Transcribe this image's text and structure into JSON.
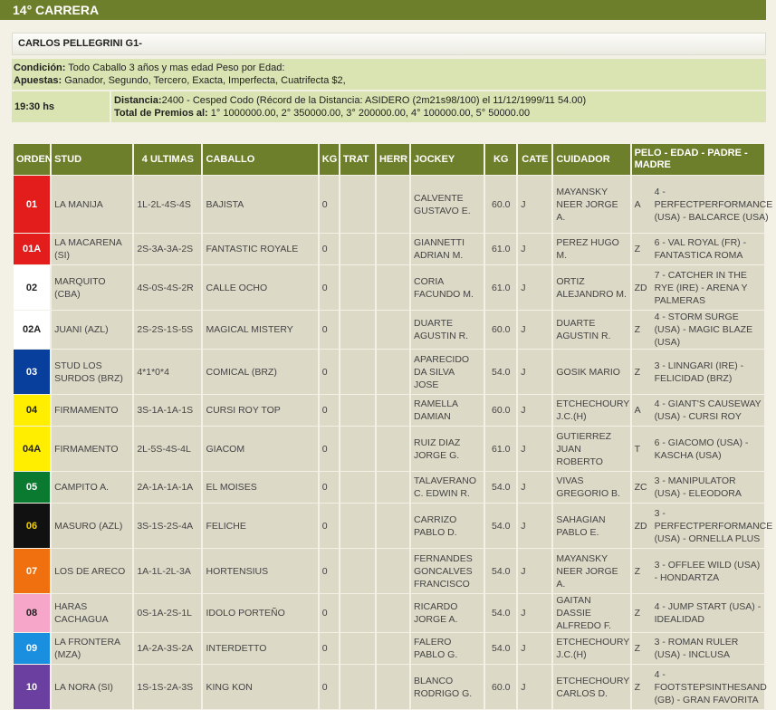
{
  "race": {
    "header": "14° CARRERA",
    "name": "CARLOS PELLEGRINI G1-",
    "condicion_label": "Condición:",
    "condicion": "Todo Caballo 3 años y mas edad Peso por Edad:",
    "apuestas_label": "Apuestas:",
    "apuestas": "Ganador, Segundo, Tercero, Exacta, Imperfecta, Cuatrifecta $2,",
    "hora": "19:30 hs",
    "distancia_label": "Distancia:",
    "distancia": "2400 - Cesped Codo (Récord de la Distancia: ASIDERO (2m21s98/100) el 11/12/1999/11 54.00)",
    "premios_label": "Total de Premios al:",
    "premios": "1° 1000000.00, 2° 350000.00, 3° 200000.00, 4° 100000.00, 5° 50000.00"
  },
  "columns": [
    "ORDEN",
    "STUD",
    "4 ULTIMAS",
    "CABALLO",
    "KG",
    "TRAT",
    "HERR",
    "JOCKEY",
    "KG",
    "CATE",
    "CUIDADOR",
    "PELO - EDAD - PADRE - MADRE"
  ],
  "rows": [
    {
      "orden": "01",
      "color": "#e31c1c",
      "text_color": "#ffffff",
      "stud": "LA MANIJA",
      "ultimas": "1L-2L-4S-4S",
      "caballo": "BAJISTA",
      "kg": "0",
      "trat": "",
      "herr": "",
      "jockey": "CALVENTE GUSTAVO E.",
      "kg2": "60.0",
      "cate": "J",
      "cuidador": "MAYANSKY NEER JORGE A.",
      "pelo": "A",
      "padre": "4 - PERFECTPERFORMANCE (USA) - BALCARCE (USA)"
    },
    {
      "orden": "01A",
      "color": "#e31c1c",
      "text_color": "#ffffff",
      "stud": "LA MACARENA (SI)",
      "ultimas": "2S-3A-3A-2S",
      "caballo": "FANTASTIC ROYALE",
      "kg": "0",
      "trat": "",
      "herr": "",
      "jockey": "GIANNETTI ADRIAN M.",
      "kg2": "61.0",
      "cate": "J",
      "cuidador": "PEREZ HUGO M.",
      "pelo": "Z",
      "padre": "6 - VAL ROYAL (FR) - FANTASTICA ROMA"
    },
    {
      "orden": "02",
      "color": "#ffffff",
      "text_color": "#222222",
      "stud": "MARQUITO (CBA)",
      "ultimas": "4S-0S-4S-2R",
      "caballo": "CALLE OCHO",
      "kg": "0",
      "trat": "",
      "herr": "",
      "jockey": "CORIA FACUNDO M.",
      "kg2": "61.0",
      "cate": "J",
      "cuidador": "ORTIZ ALEJANDRO M.",
      "pelo": "ZD",
      "padre": "7 - CATCHER IN THE RYE (IRE) - ARENA Y PALMERAS"
    },
    {
      "orden": "02A",
      "color": "#ffffff",
      "text_color": "#222222",
      "stud": "JUANI (AZL)",
      "ultimas": "2S-2S-1S-5S",
      "caballo": "MAGICAL MISTERY",
      "kg": "0",
      "trat": "",
      "herr": "",
      "jockey": "DUARTE AGUSTIN R.",
      "kg2": "60.0",
      "cate": "J",
      "cuidador": "DUARTE AGUSTIN R.",
      "pelo": "Z",
      "padre": "4 - STORM SURGE (USA) - MAGIC BLAZE (USA)"
    },
    {
      "orden": "03",
      "color": "#083f9c",
      "text_color": "#ffffff",
      "stud": "STUD LOS SURDOS (BRZ)",
      "ultimas": "4*1*0*4",
      "caballo": "COMICAL (BRZ)",
      "kg": "0",
      "trat": "",
      "herr": "",
      "jockey": "APARECIDO DA SILVA JOSE",
      "kg2": "54.0",
      "cate": "J",
      "cuidador": "GOSIK MARIO",
      "pelo": "Z",
      "padre": "3 - LINNGARI (IRE) - FELICIDAD (BRZ)"
    },
    {
      "orden": "04",
      "color": "#ffee00",
      "text_color": "#222222",
      "stud": "FIRMAMENTO",
      "ultimas": "3S-1A-1A-1S",
      "caballo": "CURSI ROY TOP",
      "kg": "0",
      "trat": "",
      "herr": "",
      "jockey": "RAMELLA DAMIAN",
      "kg2": "60.0",
      "cate": "J",
      "cuidador": "ETCHECHOURY J.C.(H)",
      "pelo": "A",
      "padre": "4 - GIANT'S CAUSEWAY (USA) - CURSI ROY"
    },
    {
      "orden": "04A",
      "color": "#ffee00",
      "text_color": "#222222",
      "stud": "FIRMAMENTO",
      "ultimas": "2L-5S-4S-4L",
      "caballo": "GIACOM",
      "kg": "0",
      "trat": "",
      "herr": "",
      "jockey": "RUIZ DIAZ JORGE G.",
      "kg2": "61.0",
      "cate": "J",
      "cuidador": "GUTIERREZ JUAN ROBERTO",
      "pelo": "T",
      "padre": "6 - GIACOMO (USA) - KASCHA (USA)"
    },
    {
      "orden": "05",
      "color": "#0a7a30",
      "text_color": "#ffffff",
      "stud": "CAMPITO A.",
      "ultimas": "2A-1A-1A-1A",
      "caballo": "EL MOISES",
      "kg": "0",
      "trat": "",
      "herr": "",
      "jockey": "TALAVERANO C. EDWIN R.",
      "kg2": "54.0",
      "cate": "J",
      "cuidador": "VIVAS GREGORIO B.",
      "pelo": "ZC",
      "padre": "3 - MANIPULATOR (USA) - ELEODORA"
    },
    {
      "orden": "06",
      "color": "#111111",
      "text_color": "#f0d000",
      "stud": "MASURO (AZL)",
      "ultimas": "3S-1S-2S-4A",
      "caballo": "FELICHE",
      "kg": "0",
      "trat": "",
      "herr": "",
      "jockey": "CARRIZO PABLO D.",
      "kg2": "54.0",
      "cate": "J",
      "cuidador": "SAHAGIAN PABLO E.",
      "pelo": "ZD",
      "padre": "3 - PERFECTPERFORMANCE (USA) - ORNELLA PLUS"
    },
    {
      "orden": "07",
      "color": "#f07010",
      "text_color": "#ffffff",
      "stud": "LOS DE ARECO",
      "ultimas": "1A-1L-2L-3A",
      "caballo": "HORTENSIUS",
      "kg": "0",
      "trat": "",
      "herr": "",
      "jockey": "FERNANDES GONCALVES FRANCISCO",
      "kg2": "54.0",
      "cate": "J",
      "cuidador": "MAYANSKY NEER JORGE A.",
      "pelo": "Z",
      "padre": "3 - OFFLEE WILD (USA) - HONDARTZA"
    },
    {
      "orden": "08",
      "color": "#f6a6c8",
      "text_color": "#222222",
      "stud": "HARAS CACHAGUA",
      "ultimas": "0S-1A-2S-1L",
      "caballo": "IDOLO PORTEÑO",
      "kg": "0",
      "trat": "",
      "herr": "",
      "jockey": "RICARDO JORGE A.",
      "kg2": "54.0",
      "cate": "J",
      "cuidador": "GAITAN DASSIE ALFREDO F.",
      "pelo": "Z",
      "padre": "4 - JUMP START (USA) - IDEALIDAD"
    },
    {
      "orden": "09",
      "color": "#1a8fe0",
      "text_color": "#ffffff",
      "stud": "LA FRONTERA (MZA)",
      "ultimas": "1A-2A-3S-2A",
      "caballo": "INTERDETTO",
      "kg": "0",
      "trat": "",
      "herr": "",
      "jockey": "FALERO PABLO G.",
      "kg2": "54.0",
      "cate": "J",
      "cuidador": "ETCHECHOURY J.C.(H)",
      "pelo": "Z",
      "padre": "3 - ROMAN RULER (USA) - INCLUSA"
    },
    {
      "orden": "10",
      "color": "#6a3fa0",
      "text_color": "#ffffff",
      "stud": "LA NORA (SI)",
      "ultimas": "1S-1S-2A-3S",
      "caballo": "KING KON",
      "kg": "0",
      "trat": "",
      "herr": "",
      "jockey": "BLANCO RODRIGO G.",
      "kg2": "60.0",
      "cate": "J",
      "cuidador": "ETCHECHOURY CARLOS D.",
      "pelo": "Z",
      "padre": "4 - FOOTSTEPSINTHESAND (GB) - GRAN FAVORITA"
    }
  ]
}
